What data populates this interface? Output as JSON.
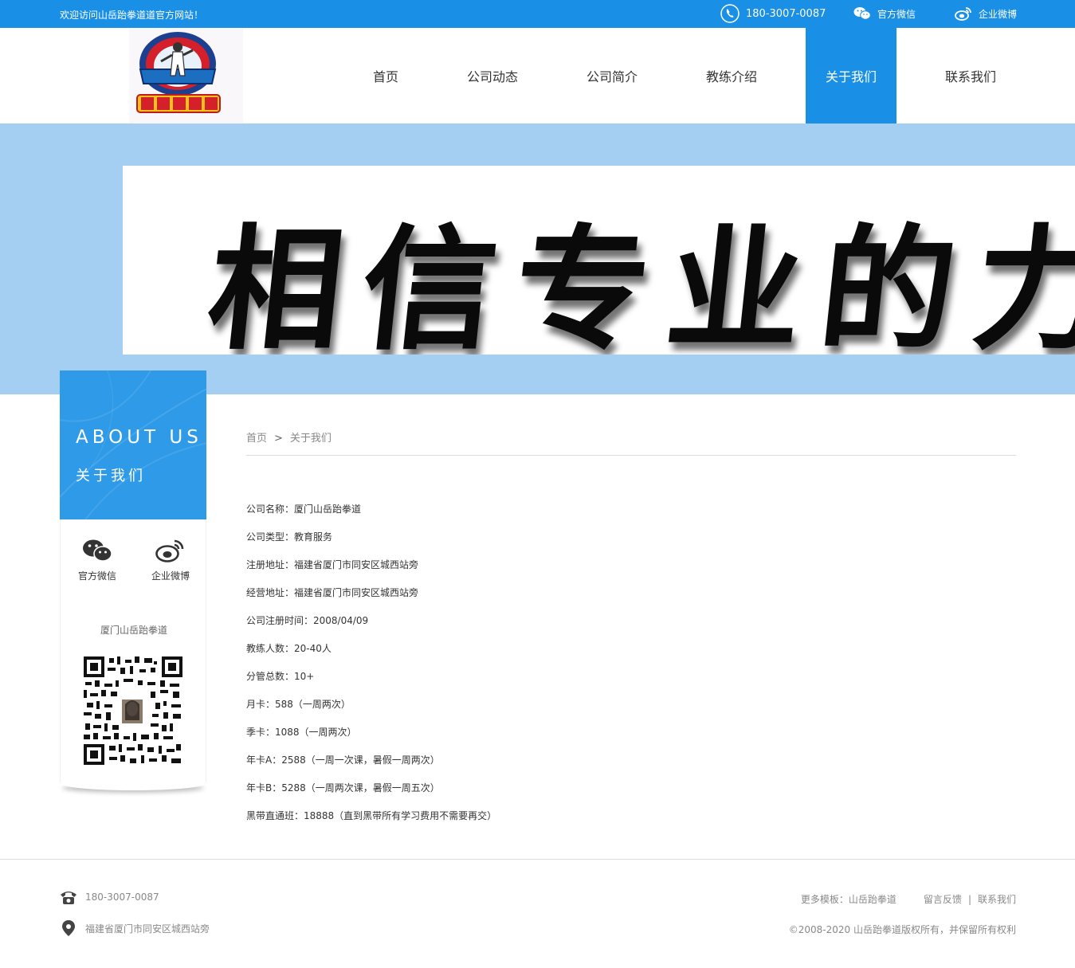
{
  "topbar": {
    "welcome": "欢迎访问山岳跆拳道道官方网站！",
    "phone": "180-3007-0087",
    "wechat": "官方微信",
    "weibo": "企业微博"
  },
  "nav": [
    "首页",
    "公司动态",
    "公司简介",
    "教练介绍",
    "关于我们",
    "联系我们"
  ],
  "nav_active": "关于我们",
  "logo": {
    "text_top": "TAEKWONDO",
    "text_mid": "SHAN YUE",
    "text_cn": "山岳跆拳道"
  },
  "banner": {
    "text": "相信专业的力"
  },
  "sidebar": {
    "title_en": "ABOUT US",
    "title_cn": "关于我们",
    "wechat_label": "官方微信",
    "weibo_label": "企业微博",
    "company_name": "厦门山岳跆拳道"
  },
  "breadcrumb": {
    "home": "首页",
    "sep": ">",
    "current": "关于我们"
  },
  "info": [
    "公司名称：厦门山岳跆拳道",
    "公司类型：教育服务",
    "注册地址：福建省厦门市同安区城西站旁",
    "经营地址：福建省厦门市同安区城西站旁",
    "公司注册时间：2008/04/09",
    "教练人数：20-40人",
    "分管总数：10+",
    "月卡：588（一周两次）",
    "季卡：1088（一周两次）",
    "年卡A：2588（一周一次课，暑假一周两次）",
    "年卡B：5288（一周两次课，暑假一周五次）",
    "黑带直通班：18888（直到黑带所有学习费用不需要再交）"
  ],
  "footer": {
    "phone": "180-3007-0087",
    "address": "福建省厦门市同安区城西站旁",
    "more": "更多模板：山岳跆拳道",
    "feedback": "留言反馈",
    "divider": "|",
    "contact": "联系我们",
    "copyright": "©2008-2020 山岳跆拳道版权所有，并保留所有权利"
  },
  "colors": {
    "primary": "#1a8fe6",
    "banner_bg": "#a4cff3",
    "sidebar_head": "#2e9ae8"
  },
  "icons": [
    "phone-icon",
    "wechat-icon",
    "weibo-icon",
    "telephone-icon",
    "location-icon",
    "qr-code"
  ]
}
